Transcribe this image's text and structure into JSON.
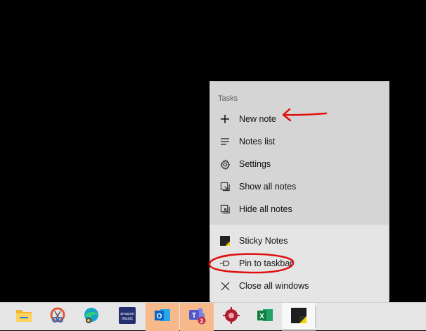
{
  "jumplist": {
    "group_title": "Tasks",
    "tasks": [
      {
        "label": "New note",
        "icon": "plus-icon"
      },
      {
        "label": "Notes list",
        "icon": "list-icon"
      },
      {
        "label": "Settings",
        "icon": "gear-icon"
      },
      {
        "label": "Show all notes",
        "icon": "show-windows-icon"
      },
      {
        "label": "Hide all notes",
        "icon": "hide-windows-icon"
      }
    ],
    "app_items": [
      {
        "label": "Sticky Notes",
        "icon": "sticky-notes-icon"
      },
      {
        "label": "Pin to taskbar",
        "icon": "pin-icon"
      },
      {
        "label": "Close all windows",
        "icon": "close-icon"
      }
    ]
  },
  "taskbar": {
    "apps": [
      {
        "name": "File Explorer",
        "icon": "folder-icon"
      },
      {
        "name": "Snipping tool",
        "icon": "snip-icon"
      },
      {
        "name": "Edge",
        "icon": "edge-icon"
      },
      {
        "name": "Amazon Music",
        "icon": "amazon-music-icon",
        "text": "amazon\nmusic"
      },
      {
        "name": "Outlook",
        "icon": "outlook-icon",
        "text": "O"
      },
      {
        "name": "Teams",
        "icon": "teams-icon",
        "text": "T",
        "badge": "2"
      },
      {
        "name": "App",
        "icon": "red-app-icon"
      },
      {
        "name": "Excel",
        "icon": "excel-icon",
        "text": "X"
      },
      {
        "name": "Sticky Notes",
        "icon": "sticky-notes-icon"
      }
    ]
  },
  "colors": {
    "annotation": "#e01010",
    "taskbar_highlight": "#f7b98a",
    "jumplist_bg": "#d5d5d5"
  }
}
